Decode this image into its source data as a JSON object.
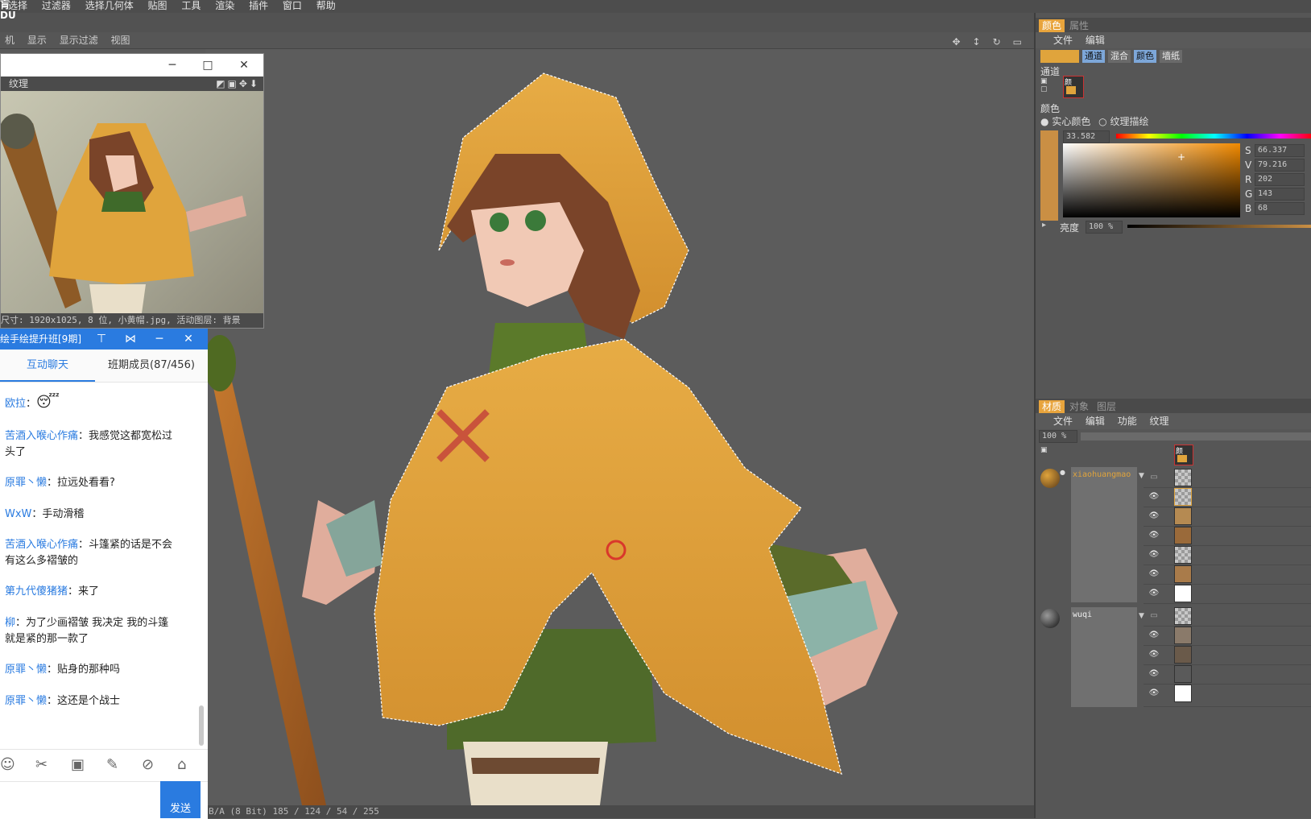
{
  "menubar": {
    "items": [
      "选择",
      "过滤器",
      "选择几何体",
      "贴图",
      "工具",
      "渲染",
      "插件",
      "窗口",
      "帮助"
    ]
  },
  "viewbar": {
    "items": [
      "机",
      "显示",
      "显示过滤",
      "视图"
    ]
  },
  "texture_window": {
    "toolbar_label": "纹理",
    "info": "尺寸: 1920x1025, 8 位, 小黄帽.jpg, 活动图层: 背景"
  },
  "chat": {
    "title": "绘手绘提升班[9期]",
    "tab_chat": "互动聊天",
    "tab_members": "班期成员(87/456)",
    "messages": [
      {
        "name": "欧拉",
        "text": "😴"
      },
      {
        "name": "苦酒入喉心作痛",
        "text": "我感觉这都宽松过头了"
      },
      {
        "name": "原罪丶懒",
        "text": "拉远处看看?"
      },
      {
        "name": "WxW",
        "text": "手动滑稽"
      },
      {
        "name": "苦酒入喉心作痛",
        "text": "斗篷紧的话是不会有这么多褶皱的"
      },
      {
        "name": "第九代傻猪猪",
        "text": "来了"
      },
      {
        "name": "柳",
        "text": "为了少画褶皱 我决定 我的斗篷 就是紧的那一款了"
      },
      {
        "name": "原罪丶懒",
        "text": "贴身的那种吗"
      },
      {
        "name": "原罪丶懒",
        "text": "这还是个战士"
      }
    ],
    "send_label": "发送"
  },
  "color_panel": {
    "tab_color": "颜色",
    "tab_attr": "属性",
    "menu_file": "文件",
    "menu_edit": "编辑",
    "mode_buttons": [
      "通道",
      "混合",
      "颜色",
      "墙纸"
    ],
    "section_channel": "通道",
    "section_color": "颜色",
    "radio_solid": "实心颜色",
    "radio_texture": "纹理描绘",
    "hue_value": "33.582",
    "s_label": "S",
    "s_value": "66.337",
    "v_label": "V",
    "v_value": "79.216",
    "r_label": "R",
    "r_value": "202",
    "g_label": "G",
    "g_value": "143",
    "b_label": "B",
    "b_value": "68",
    "brightness_label": "亮度",
    "brightness_value": "100 %",
    "channel_tag": "颜",
    "current_color": "#ca8f44"
  },
  "material_panel": {
    "tab_material": "材质",
    "tab_object": "对象",
    "tab_layer": "图层",
    "menu_file": "文件",
    "menu_edit": "编辑",
    "menu_function": "功能",
    "menu_texture": "纹理",
    "zoom_value": "100 %",
    "channel_tag": "颜",
    "materials": [
      {
        "name": "xiaohuangmao"
      },
      {
        "name": "wuqi"
      }
    ]
  },
  "statusbar": {
    "text": "B/A (8 Bit) 185 / 124 / 54 / 255"
  }
}
